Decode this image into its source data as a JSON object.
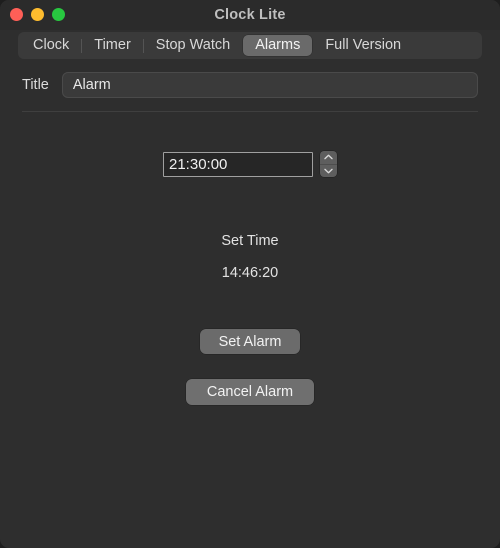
{
  "window": {
    "title": "Clock Lite",
    "traffic_lights": [
      {
        "name": "close",
        "color": "#ff5f57"
      },
      {
        "name": "minimize",
        "color": "#febc2e"
      },
      {
        "name": "zoom",
        "color": "#28c840"
      }
    ]
  },
  "tabs": [
    {
      "label": "Clock",
      "selected": false
    },
    {
      "label": "Timer",
      "selected": false
    },
    {
      "label": "Stop Watch",
      "selected": false
    },
    {
      "label": "Alarms",
      "selected": true
    },
    {
      "label": "Full Version",
      "selected": false
    }
  ],
  "form": {
    "title_label": "Title",
    "title_value": "Alarm",
    "title_placeholder": "Title"
  },
  "alarm": {
    "time_value": "21:30:00",
    "stepper_up_icon": "chevron-up-icon",
    "stepper_down_icon": "chevron-down-icon"
  },
  "set_time": {
    "label": "Set Time",
    "value": "14:46:20"
  },
  "actions": {
    "set_alarm_label": "Set Alarm",
    "cancel_alarm_label": "Cancel Alarm"
  },
  "colors": {
    "window_bg": "#2e2e2e",
    "titlebar_bg": "#2b2b2b",
    "tabbar_bg": "#3a3a3a",
    "tab_selected_bg": "#6a6a6a",
    "button_bg": "#6b6b6b",
    "text": "#e2e2e2"
  }
}
